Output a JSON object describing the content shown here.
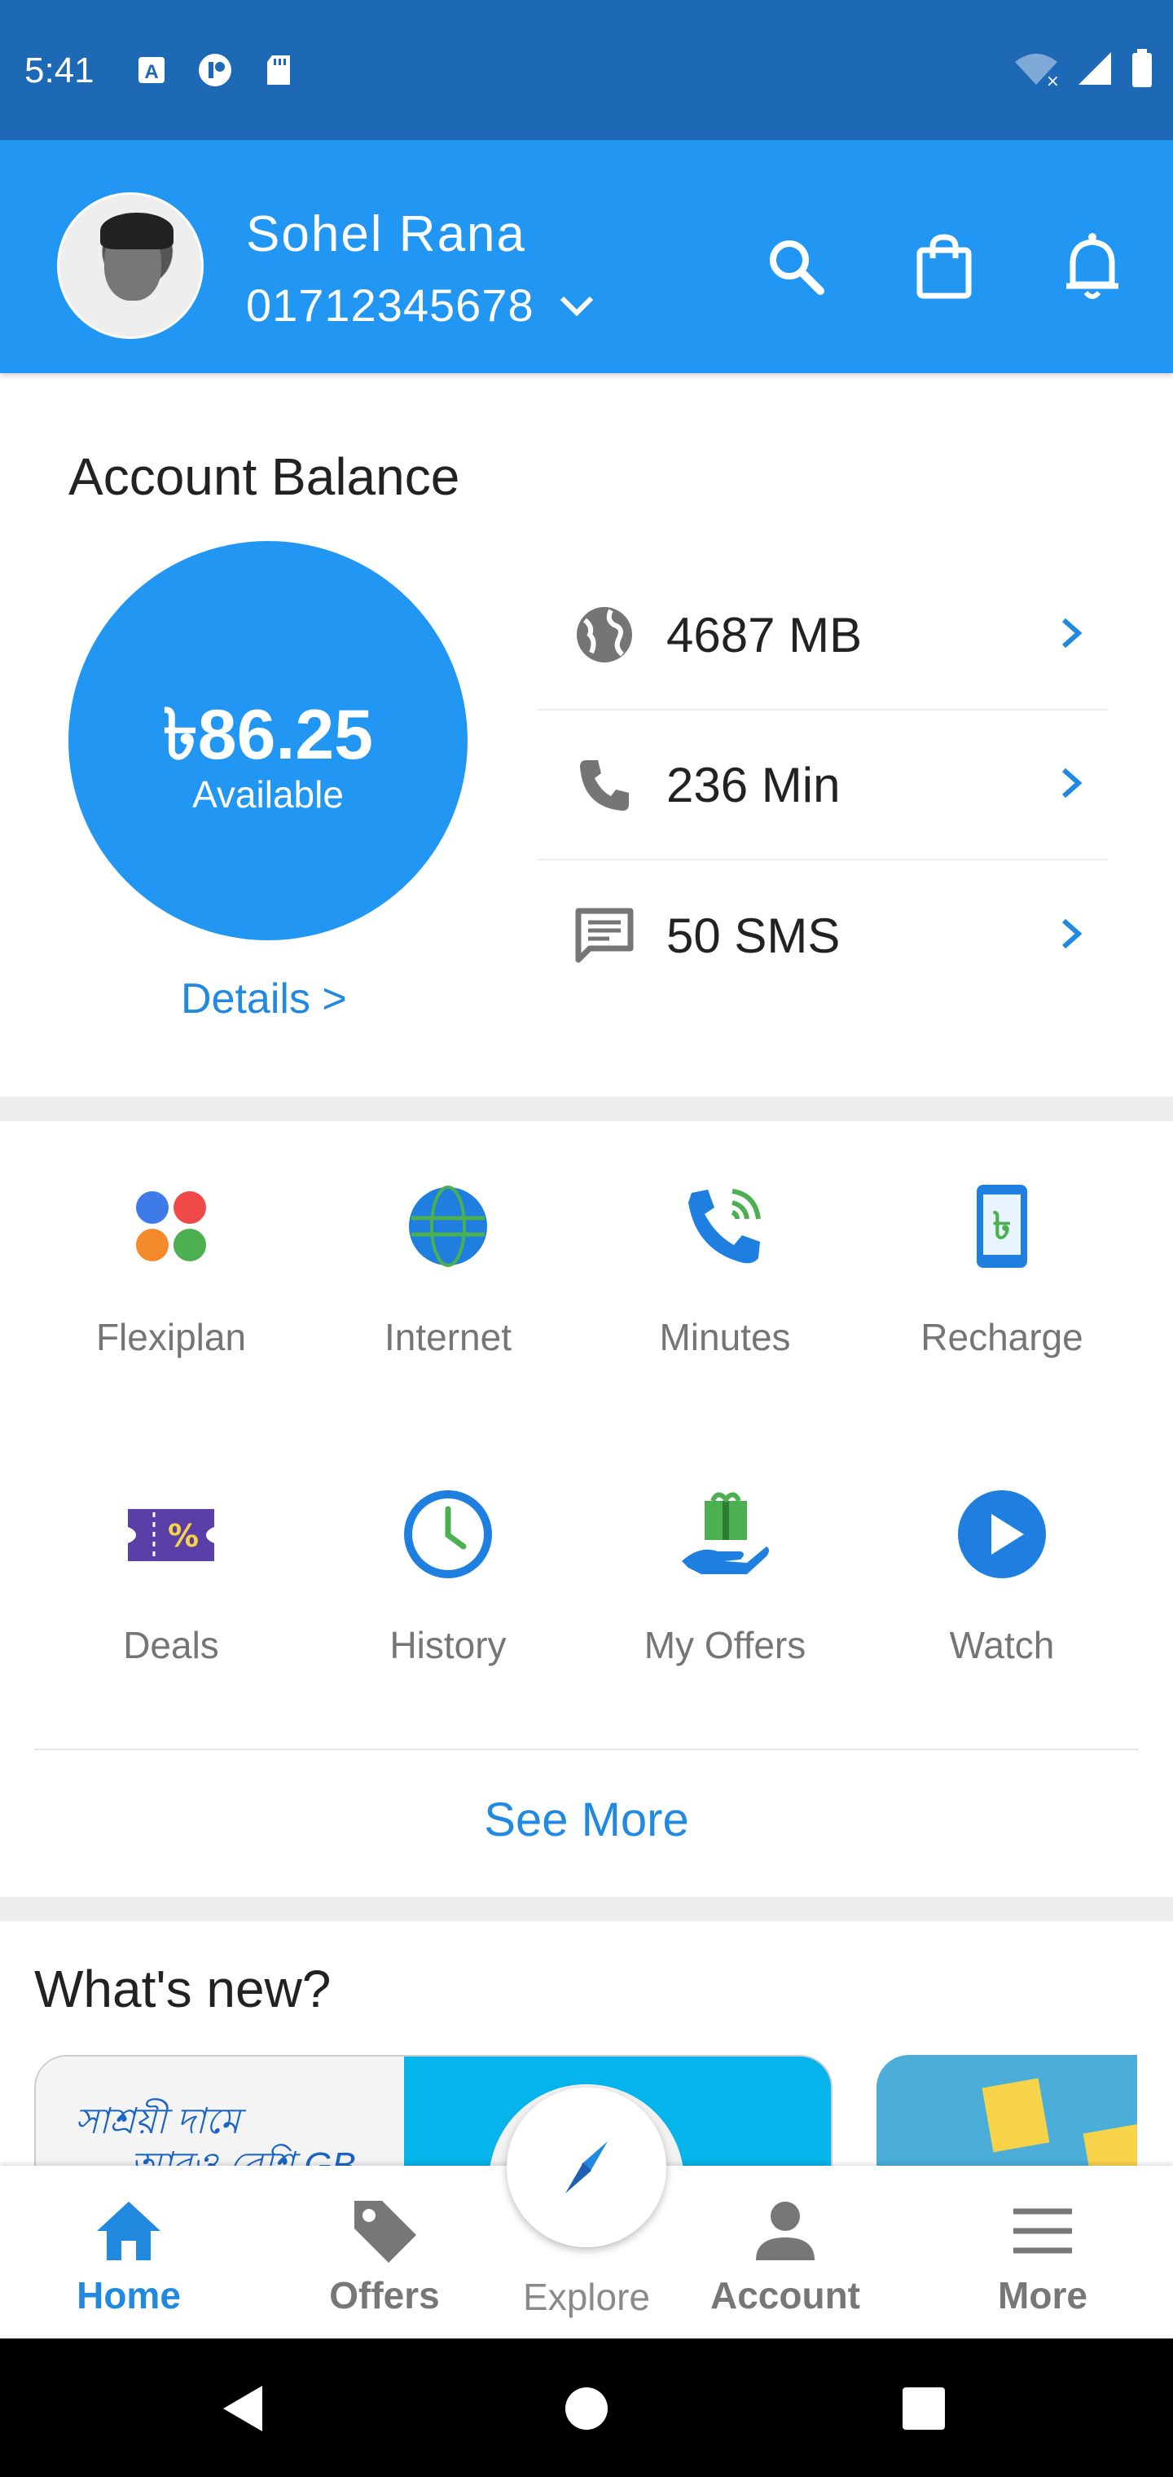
{
  "status_bar": {
    "time": "5:41"
  },
  "header": {
    "user_name": "Sohel Rana",
    "phone_number": "01712345678"
  },
  "balance": {
    "title": "Account Balance",
    "amount": "৳86.25",
    "amount_label": "Available",
    "details_link": "Details >"
  },
  "usage": [
    {
      "icon": "globe-icon",
      "value": "4687 MB"
    },
    {
      "icon": "phone-icon",
      "value": "236 Min"
    },
    {
      "icon": "sms-icon",
      "value": "50 SMS"
    }
  ],
  "services": [
    {
      "icon": "flexiplan-icon",
      "label": "Flexiplan"
    },
    {
      "icon": "internet-icon",
      "label": "Internet"
    },
    {
      "icon": "minutes-icon",
      "label": "Minutes"
    },
    {
      "icon": "recharge-icon",
      "label": "Recharge"
    },
    {
      "icon": "deals-icon",
      "label": "Deals"
    },
    {
      "icon": "history-icon",
      "label": "History"
    },
    {
      "icon": "my-offers-icon",
      "label": "My Offers"
    },
    {
      "icon": "watch-icon",
      "label": "Watch"
    }
  ],
  "see_more": "See More",
  "whats_new": {
    "title": "What's new?",
    "banner_line1": "সাশ্রয়ী দামে",
    "banner_line2": "আরও বেশি GB"
  },
  "bottom_nav": [
    {
      "icon": "home-icon",
      "label": "Home",
      "active": true
    },
    {
      "icon": "tag-icon",
      "label": "Offers",
      "active": false
    },
    {
      "icon": "compass-icon",
      "label": "Explore",
      "active": false
    },
    {
      "icon": "person-icon",
      "label": "Account",
      "active": false
    },
    {
      "icon": "menu-icon",
      "label": "More",
      "active": false
    }
  ],
  "colors": {
    "primary": "#2296f3",
    "status_bar": "#1d69b5",
    "link": "#2189e0"
  }
}
